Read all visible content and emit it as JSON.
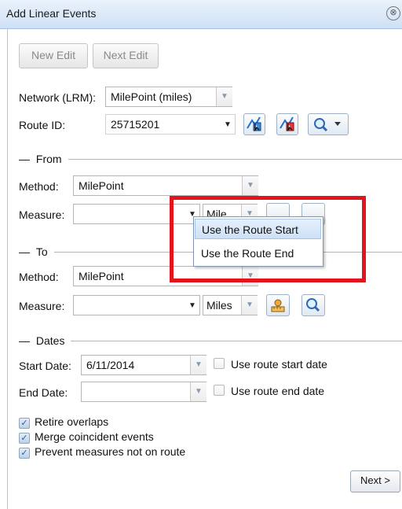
{
  "window": {
    "title": "Add Linear Events",
    "close_glyph": "⊗"
  },
  "toolbar": {
    "new_edit_label": "New Edit",
    "next_edit_label": "Next Edit"
  },
  "network": {
    "label": "Network (LRM):",
    "value": "MilePoint (miles)"
  },
  "route": {
    "label": "Route ID:",
    "value": "25715201"
  },
  "from": {
    "section_label": "From",
    "method_label": "Method:",
    "method_value": "MilePoint",
    "measure_label": "Measure:",
    "measure_value": "",
    "units_value": "Mile"
  },
  "to": {
    "section_label": "To",
    "method_label": "Method:",
    "method_value": "MilePoint",
    "measure_label": "Measure:",
    "measure_value": "",
    "units_value": "Miles"
  },
  "dates": {
    "section_label": "Dates",
    "start_label": "Start Date:",
    "start_value": "6/11/2014",
    "end_label": "End Date:",
    "end_value": "",
    "use_route_start": "Use route start date",
    "use_route_end": "Use route end date"
  },
  "options": {
    "retire_overlaps": "Retire overlaps",
    "merge_coincident": "Merge coincident events",
    "prevent_measures": "Prevent measures not on route"
  },
  "dropdown_menu": {
    "items": [
      "Use the Route Start",
      "Use the Route End"
    ]
  },
  "footer": {
    "next_label": "Next >"
  },
  "colors": {
    "highlight_border": "#e3141e",
    "title_bar": "#d6e6f8"
  }
}
